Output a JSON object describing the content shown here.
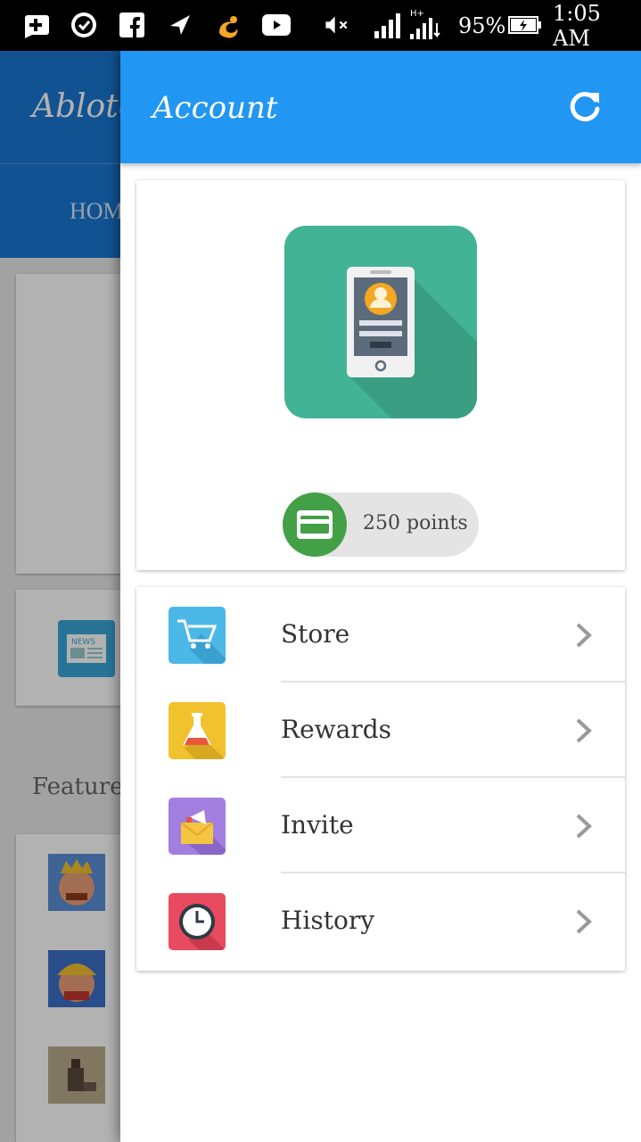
{
  "status_bar": {
    "battery": "95%",
    "time": "1:05 AM",
    "network": "H+"
  },
  "background_app": {
    "title": "Ablotc",
    "tab": "HOM",
    "featured_label": "Featured"
  },
  "drawer": {
    "title": "Account",
    "points": "250 points",
    "menu": [
      {
        "label": "Store",
        "icon": "cart-icon",
        "color": "#4cb8e8"
      },
      {
        "label": "Rewards",
        "icon": "flask-icon",
        "color": "#f2c12e"
      },
      {
        "label": "Invite",
        "icon": "invite-envelope-icon",
        "color": "#a27ee0"
      },
      {
        "label": "History",
        "icon": "clock-icon",
        "color": "#e84a5f"
      }
    ]
  },
  "colors": {
    "drawer_bar": "#2196f3",
    "bg_appbar": "#1976d2",
    "phone_tile": "#42b395",
    "points_badge": "#43a047"
  }
}
